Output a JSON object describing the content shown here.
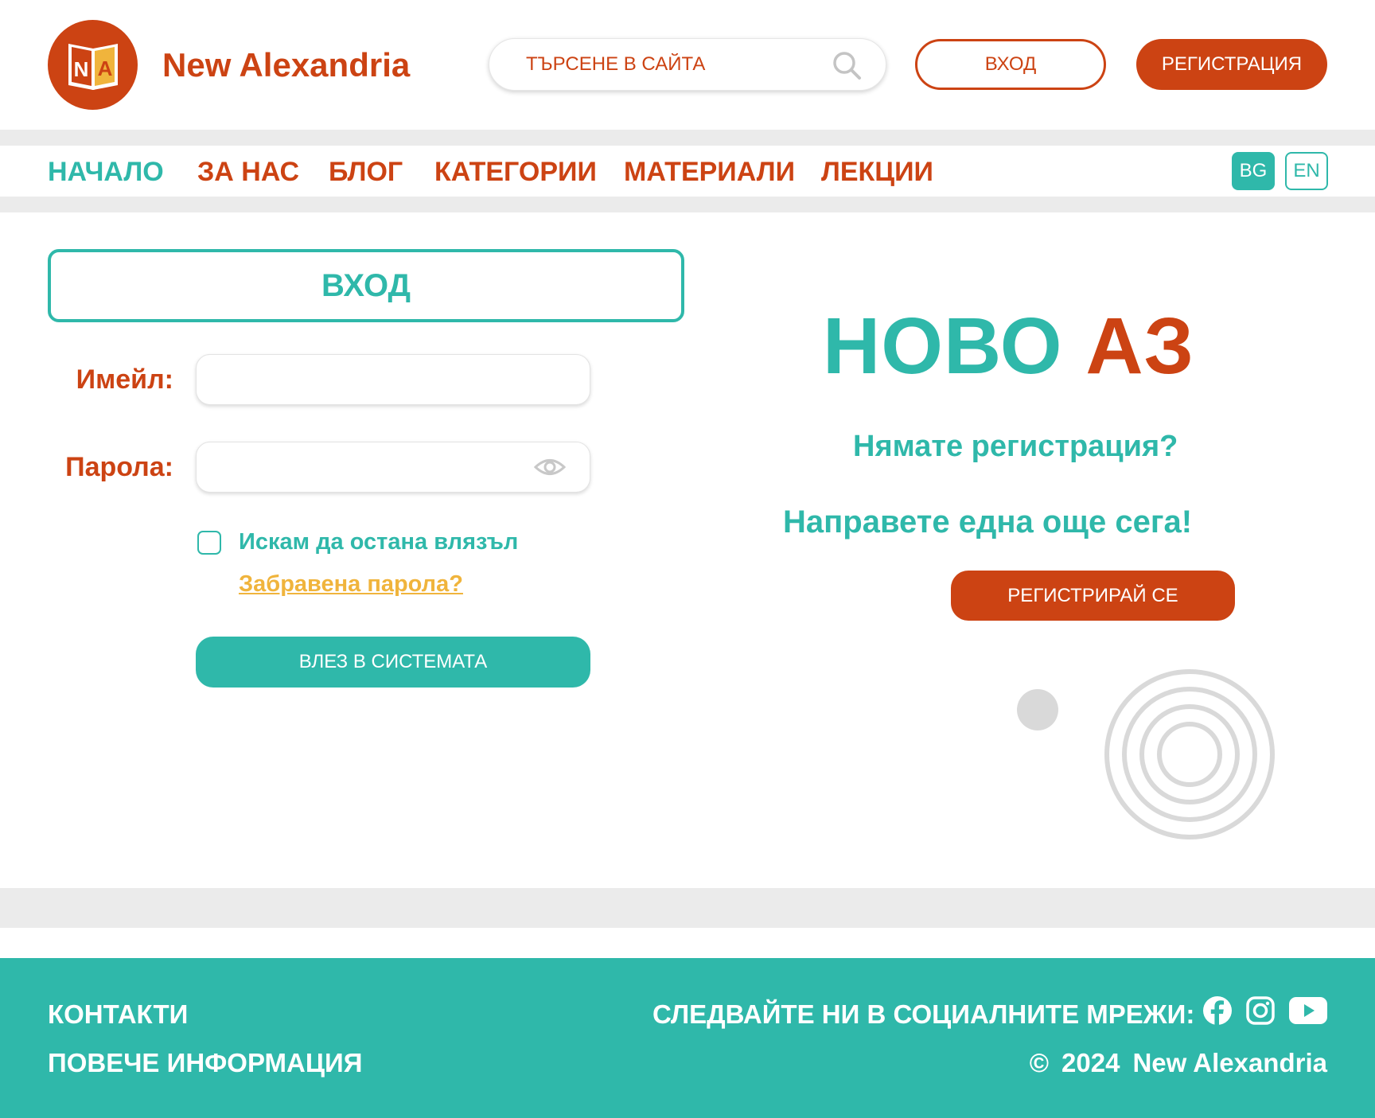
{
  "header": {
    "brand": "New Alexandria",
    "logo_letters": {
      "left": "N",
      "right": "A"
    },
    "search_placeholder": "ТЪРСЕНЕ В САЙТА",
    "login_label": "ВХОД",
    "register_label": "РЕГИСТРАЦИЯ"
  },
  "nav": {
    "items": [
      {
        "label": "НАЧАЛО",
        "active": true
      },
      {
        "label": "ЗА НАС"
      },
      {
        "label": "БЛОГ"
      },
      {
        "label": "КАТЕГОРИИ"
      },
      {
        "label": "МАТЕРИАЛИ"
      },
      {
        "label": "ЛЕКЦИИ"
      }
    ],
    "languages": [
      "BG",
      "EN"
    ],
    "active_language": "BG"
  },
  "login": {
    "title": "ВХОД",
    "email_label": "Имейл:",
    "email_value": "",
    "password_label": "Парола:",
    "password_value": "",
    "remember_label": "Искам да остана влязъл",
    "remember_checked": false,
    "forgot_label": "Забравена парола?",
    "submit_label": "ВЛЕЗ В СИСТЕМАТА"
  },
  "promo": {
    "title_word1": "НОВО",
    "title_word2": "АЗ",
    "question": "Нямате регистрация?",
    "cta_text": "Направете една още сега!",
    "button_label": "РЕГИСТРИРАЙ СЕ"
  },
  "footer": {
    "contacts": "КОНТАКТИ",
    "more_info": "ПОВЕЧЕ ИНФОРМАЦИЯ",
    "follow": "СЛЕДВАЙТЕ НИ В СОЦИАЛНИТЕ МРЕЖИ:",
    "social_icons": [
      "facebook-icon",
      "instagram-icon",
      "youtube-icon"
    ],
    "copyright_symbol": "©",
    "year": "2024",
    "copyright_name": "New Alexandria"
  },
  "colors": {
    "orange": "#cc4313",
    "teal": "#2fb8aa",
    "yellow": "#f0b43c",
    "grey": "#ebebeb"
  }
}
